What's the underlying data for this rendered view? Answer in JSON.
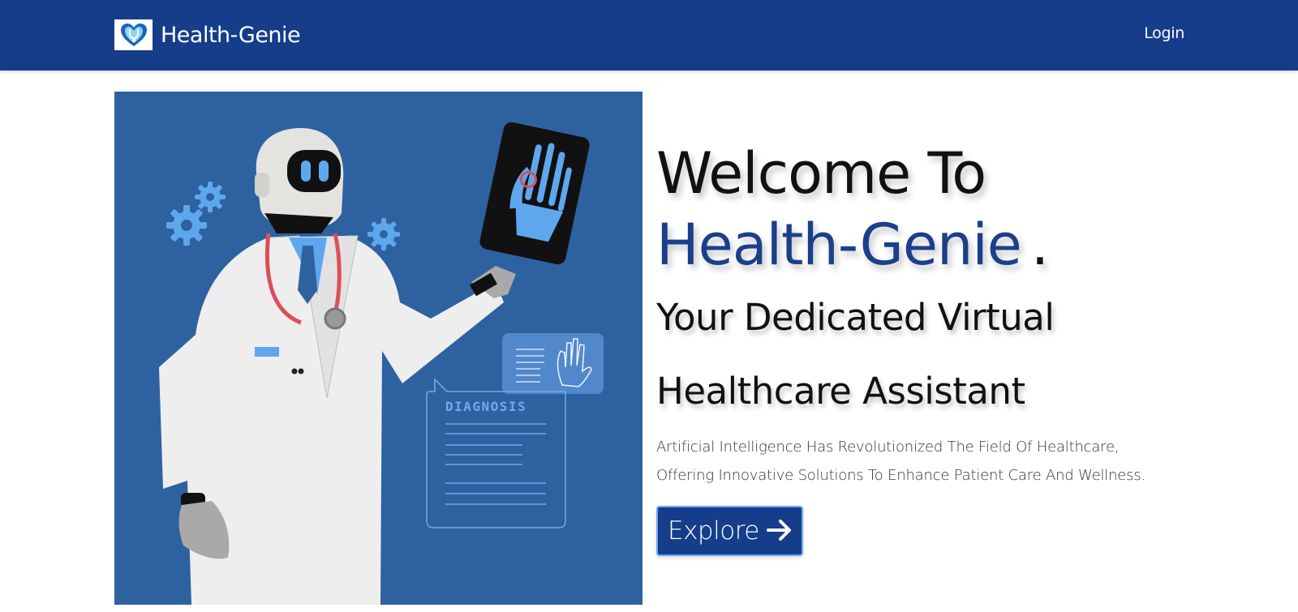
{
  "nav": {
    "brand_name": "Health-Genie",
    "logo_icon": "heart-stethoscope-icon",
    "login_label": "Login"
  },
  "hero": {
    "welcome_line": "Welcome To",
    "brand_line": "Health-Genie",
    "brand_suffix": ".",
    "subtitle_line1": "Your Dedicated Virtual",
    "subtitle_line2": "Healthcare Assistant",
    "description_line1": "Artificial Intelligence Has Revolutionized The Field Of Healthcare,",
    "description_line2": "Offering Innovative Solutions To Enhance Patient Care And Wellness.",
    "explore_label": "Explore",
    "explore_icon": "arrow-right-icon",
    "illustration": {
      "subject": "robot-doctor-illustration",
      "diagnosis_card_title": "DIAGNOSIS"
    }
  },
  "colors": {
    "navbar": "#153d8a",
    "brand_accent": "#1b3f8a",
    "illustration_bg": "#2e61a0",
    "button_border": "#6fa9f0"
  }
}
